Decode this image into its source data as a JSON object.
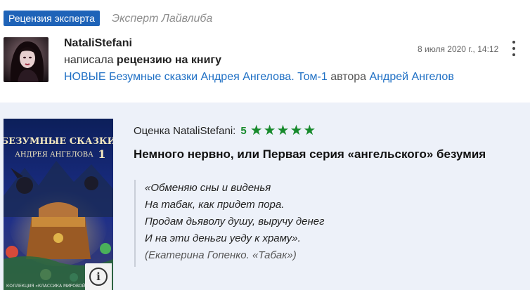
{
  "header": {
    "badge": "Рецензия эксперта",
    "expert_label": "Эксперт Лайвлиба"
  },
  "post": {
    "username": "NataliStefani",
    "action_prefix": "написала",
    "action_bold": "рецензию на книгу",
    "book_title": "НОВЫЕ Безумные сказки Андрея Ангелова. Том-1",
    "author_word": "автора",
    "author_name": "Андрей Ангелов",
    "date": "8 июля 2020 г., 14:12"
  },
  "cover": {
    "title_line1": "БЕЗУМНЫЕ СКАЗКИ",
    "title_line2": "АНДРЕЯ АНГЕЛОВА",
    "volume": "1",
    "series": "КОЛЛЕКЦИЯ «КЛАССИКА МИРОВОЙ»"
  },
  "review": {
    "rating_label": "Оценка NataliStefani:",
    "rating_value": "5",
    "stars": "★★★★★",
    "title": "Немного нервно, или Первая серия «ангельского» безумия",
    "quote_lines": [
      "«Обменяю сны и виденья",
      "На табак, как придет пора.",
      "Продам дьяволу душу, выручу денег",
      "И на эти деньги уеду к храму».",
      "(Екатерина Гопенко. «Табак»)"
    ]
  },
  "icons": {
    "menu": "kebab-menu-icon",
    "info": "info-icon"
  },
  "colors": {
    "badge_bg": "#1e63b8",
    "link": "#1e6fc4",
    "rating_green": "#178a2c",
    "panel_bg": "#edf1f9"
  }
}
